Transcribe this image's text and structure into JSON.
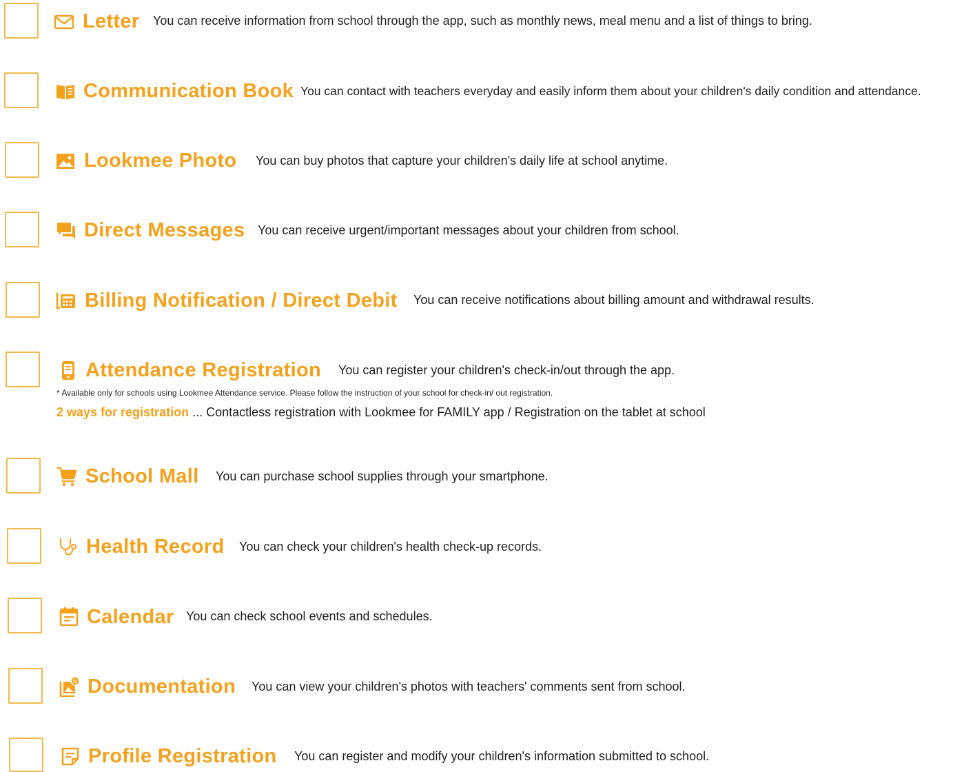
{
  "accent_color": "#f4a11e",
  "checkbox_color": "#f1b94c",
  "features": [
    {
      "icon": "envelope-icon",
      "title": "Letter",
      "description": "You can receive information from school through the app, such as monthly news, meal menu and a list of things to bring."
    },
    {
      "icon": "book-icon",
      "title": "Communication Book",
      "description": "You can contact with teachers everyday and easily inform them about your children's daily condition and attendance."
    },
    {
      "icon": "photo-icon",
      "title": "Lookmee Photo",
      "description": "You can buy photos that capture your children's daily life at school anytime."
    },
    {
      "icon": "chat-icon",
      "title": "Direct Messages",
      "description": "You can receive urgent/important messages about your children from school."
    },
    {
      "icon": "billing-icon",
      "title": "Billing Notification / Direct Debit",
      "description": "You can receive notifications about billing amount and withdrawal results."
    },
    {
      "icon": "phone-icon",
      "title": "Attendance Registration",
      "description": "You can register your children's check-in/out through the app.",
      "note": "* Available only for schools using Lookmee Attendance service. Please follow the instruction of your school for check-in/ out registration.",
      "ways_label": "2 ways for registration",
      "ways_text": " ... Contactless registration with Lookmee for FAMILY app / Registration on the tablet at school"
    },
    {
      "icon": "cart-icon",
      "title": "School Mall",
      "description": "You can purchase school supplies through your smartphone."
    },
    {
      "icon": "stethoscope-icon",
      "title": "Health Record",
      "description": "You can check your children's health check-up records."
    },
    {
      "icon": "calendar-icon",
      "title": "Calendar",
      "description": "You can check school events and schedules."
    },
    {
      "icon": "documentation-icon",
      "title": "Documentation",
      "description": "You can view your children's photos with teachers' comments sent from school."
    },
    {
      "icon": "profile-form-icon",
      "title": "Profile Registration",
      "description": "You can register and modify your children's information submitted to school."
    }
  ]
}
